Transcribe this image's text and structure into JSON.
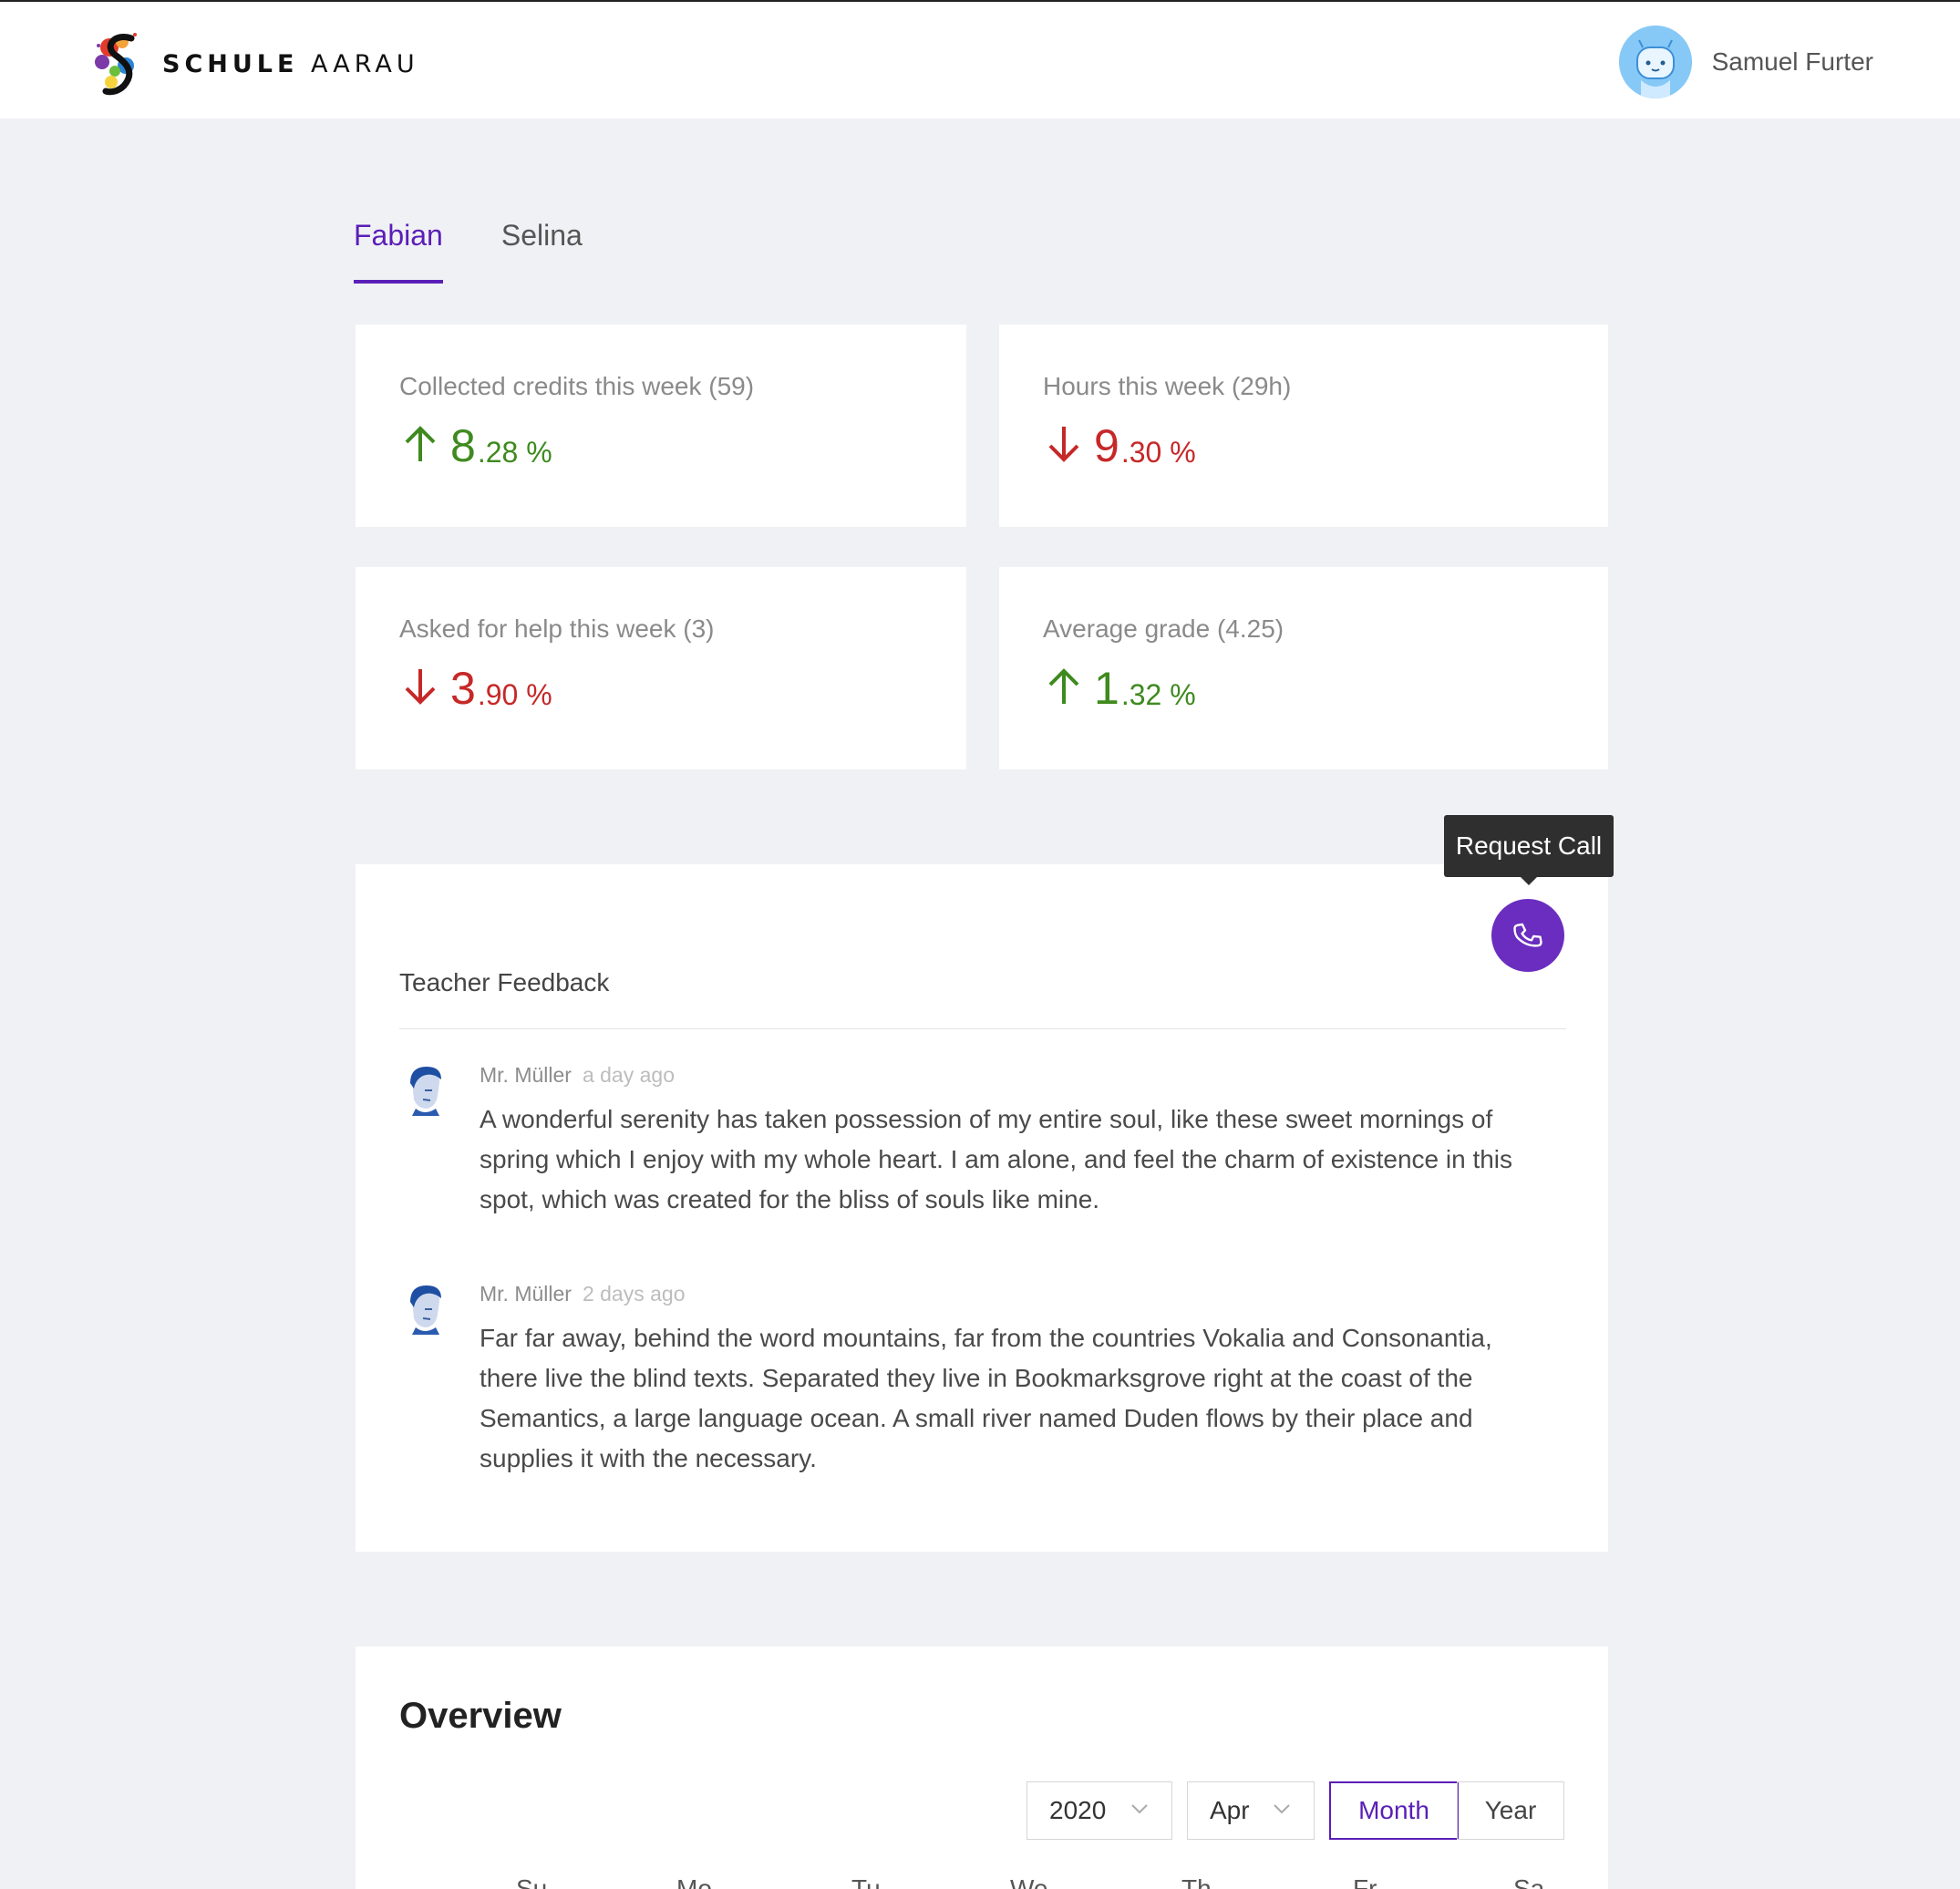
{
  "header": {
    "logo_text_bold": "SCHULE",
    "logo_text_regular": "AARAU",
    "user_name": "Samuel Furter"
  },
  "tabs": [
    {
      "label": "Fabian",
      "active": true
    },
    {
      "label": "Selina",
      "active": false
    }
  ],
  "stats": [
    {
      "label": "Collected credits this week (59)",
      "trend": "up",
      "int": "8",
      "dec": ".28 %"
    },
    {
      "label": "Hours this week (29h)",
      "trend": "down",
      "int": "9",
      "dec": ".30 %"
    },
    {
      "label": "Asked for help this week (3)",
      "trend": "down",
      "int": "3",
      "dec": ".90 %"
    },
    {
      "label": "Average grade (4.25)",
      "trend": "up",
      "int": "1",
      "dec": ".32 %"
    }
  ],
  "colors": {
    "up": "#3f8a1f",
    "down": "#c62828",
    "accent": "#5a1fb7",
    "call_button": "#6a2dbf"
  },
  "feedback": {
    "title": "Teacher Feedback",
    "request_call_tooltip": "Request Call",
    "call_icon": "phone-icon",
    "comments": [
      {
        "author": "Mr. Müller",
        "time": "a day ago",
        "text": "A wonderful serenity has taken possession of my entire soul, like these sweet mornings of spring which I enjoy with my whole heart. I am alone, and feel the charm of existence in this spot, which was created for the bliss of souls like mine."
      },
      {
        "author": "Mr. Müller",
        "time": "2 days ago",
        "text": "Far far away, behind the word mountains, far from the countries Vokalia and Consonantia, there live the blind texts. Separated they live in Bookmarksgrove right at the coast of the Semantics, a large language ocean. A small river named Duden flows by their place and supplies it with the necessary."
      }
    ]
  },
  "overview": {
    "title": "Overview",
    "year_select": "2020",
    "month_select": "Apr",
    "view_modes": [
      {
        "label": "Month",
        "active": true
      },
      {
        "label": "Year",
        "active": false
      }
    ],
    "weekdays": [
      "Su",
      "Mo",
      "Tu",
      "We",
      "Th",
      "Fr",
      "Sa"
    ]
  }
}
